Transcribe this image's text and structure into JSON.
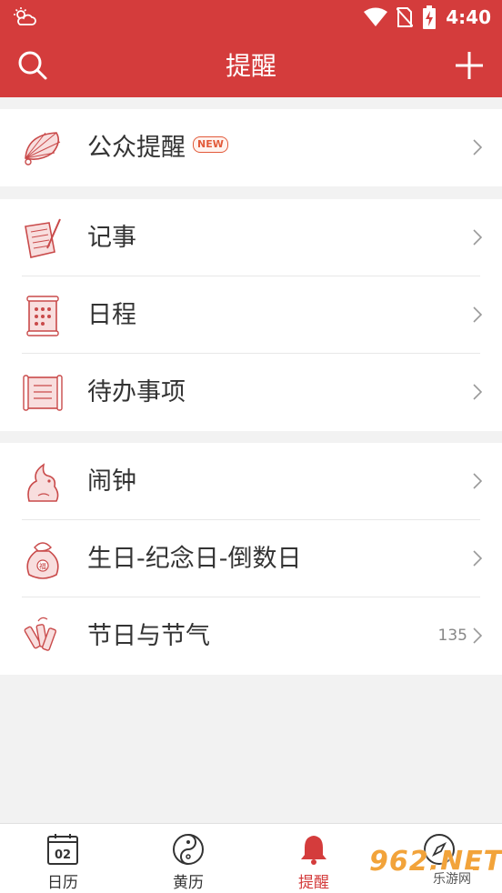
{
  "status_bar": {
    "time": "4:40"
  },
  "app_bar": {
    "title": "提醒"
  },
  "groups": [
    {
      "items": [
        {
          "label": "公众提醒",
          "badge": "NEW"
        }
      ]
    },
    {
      "items": [
        {
          "label": "记事"
        },
        {
          "label": "日程"
        },
        {
          "label": "待办事项"
        }
      ]
    },
    {
      "items": [
        {
          "label": "闹钟"
        },
        {
          "label": "生日-纪念日-倒数日"
        },
        {
          "label": "节日与节气",
          "count": "135"
        }
      ]
    }
  ],
  "tabs": [
    {
      "label": "日历",
      "icon_text": "02",
      "icon": "calendar-icon"
    },
    {
      "label": "黄历",
      "icon": "yin-yang-icon"
    },
    {
      "label": "提醒",
      "icon": "bell-icon",
      "active": true
    },
    {
      "label": "",
      "icon": "compass-icon"
    }
  ],
  "watermark": {
    "main": "962.NET",
    "sub": "乐游网"
  },
  "colors": {
    "primary": "#d43c3c",
    "icon_line": "#c94a4a",
    "icon_fill": "#f8dede"
  }
}
